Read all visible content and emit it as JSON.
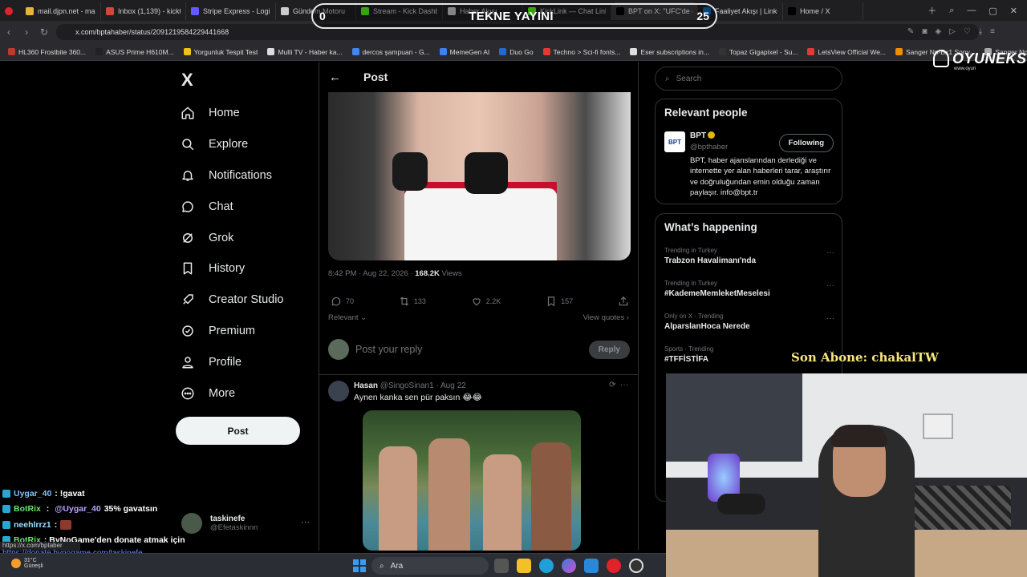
{
  "browser": {
    "tabs": [
      {
        "label": "mail.djpn.net - mail UI",
        "color": "#e7b43a"
      },
      {
        "label": "Inbox (1,139) - kicktaskin",
        "color": "#d44638"
      },
      {
        "label": "Stripe Express - Login",
        "color": "#635bff"
      },
      {
        "label": "Gündem Motoru",
        "color": "#cccccc"
      },
      {
        "label": "Stream - Kick Dashboard",
        "color": "#53fc18"
      },
      {
        "label": "Haber Akışı",
        "color": "#cccccc"
      },
      {
        "label": "KickLink — Chat Link To",
        "color": "#53fc18"
      },
      {
        "label": "BPT on X: \"UFC'de dövüşçü",
        "color": "#000000",
        "active": true
      },
      {
        "label": "Faaliyet Akışı | LinkedIn",
        "color": "#0a66c2"
      },
      {
        "label": "Home / X",
        "color": "#000000"
      }
    ],
    "url": "x.com/bptahaber/status/2091219584229441668",
    "bookmarks": [
      {
        "label": "HL360 Frostbite 360...",
        "color": "#c0392b"
      },
      {
        "label": "ASUS Prime H610M...",
        "color": "#222222"
      },
      {
        "label": "Yorgunluk Tespit Test",
        "color": "#f1c40f"
      },
      {
        "label": "Multi TV - Haber ka...",
        "color": "#dddddd"
      },
      {
        "label": "dercos şampuan - G...",
        "color": "#4285f4"
      },
      {
        "label": "MemeGen AI",
        "color": "#3b82f6"
      },
      {
        "label": "Duo Go",
        "color": "#1e6bd6"
      },
      {
        "label": "Techno > Sci-fi fonts...",
        "color": "#e53935"
      },
      {
        "label": "Eser subscriptions in...",
        "color": "#dddddd"
      },
      {
        "label": "Topaz Gigapixel - Su...",
        "color": "#333333"
      },
      {
        "label": "LetsView Official We...",
        "color": "#e53935"
      },
      {
        "label": "Sanger Np-Bx1 Sony...",
        "color": "#f08c00"
      },
      {
        "label": "Sanger Np-Bx1 Son...",
        "color": "#aaaaaa"
      }
    ]
  },
  "sidebar": {
    "logo": "X",
    "items": [
      {
        "label": "Home",
        "icon": "home-icon"
      },
      {
        "label": "Explore",
        "icon": "search-icon"
      },
      {
        "label": "Notifications",
        "icon": "bell-icon"
      },
      {
        "label": "Chat",
        "icon": "chat-icon"
      },
      {
        "label": "Grok",
        "icon": "grok-icon"
      },
      {
        "label": "History",
        "icon": "bookmark-icon"
      },
      {
        "label": "Creator Studio",
        "icon": "rocket-icon"
      },
      {
        "label": "Premium",
        "icon": "verified-icon"
      },
      {
        "label": "Profile",
        "icon": "person-icon"
      },
      {
        "label": "More",
        "icon": "more-circle-icon"
      }
    ],
    "post_button": "Post",
    "account": {
      "name": "taskinefe",
      "handle": "@Efetaskinnn"
    }
  },
  "post": {
    "header": "Post",
    "timestamp": "8:42 PM · Aug 22, 2026 · ",
    "views_count": "168.2K",
    "views_label": " Views",
    "replies": "70",
    "reposts": "133",
    "likes": "2.2K",
    "bookmarks": "157",
    "sort": "Relevant ⌄",
    "view_quotes": "View quotes ›",
    "reply_placeholder": "Post your reply",
    "reply_button": "Reply"
  },
  "reply": {
    "name": "Hasan",
    "handle": "@SingoSinan1 · Aug 22",
    "text": "Aynen kanka sen pür paksın 😂😂"
  },
  "right": {
    "search_placeholder": "Search",
    "relevant_title": "Relevant people",
    "person": {
      "avatar_text": "BPT",
      "name": "BPT",
      "handle": "@bpthaber",
      "follow": "Following",
      "bio": "BPT, haber ajanslarından derlediği ve internette yer alan haberleri tarar, araştırır ve doğruluğundan emin olduğu zaman paylaşır. info@bpt.tr"
    },
    "happening_title": "What’s happening",
    "trends": [
      {
        "context": "Trending in Turkey",
        "title": "Trabzon Havalimanı'nda"
      },
      {
        "context": "Trending in Turkey",
        "title": "#KademeMemleketMeselesi"
      },
      {
        "context": "Only on X · Trending",
        "title": "AlparslanHoca Nerede"
      },
      {
        "context": "Sports · Trending",
        "title": "#TFFİSTİFA"
      }
    ]
  },
  "overlay": {
    "score_left": "0",
    "score_title": "TEKNE YAYINI",
    "score_right": "25",
    "brand": "OYUNEKS",
    "brand_sub": "www.oyun",
    "last_sub": "Son Abone: chakalTW"
  },
  "chat": [
    {
      "user": "Uygar_40",
      "message": " : !gavat"
    },
    {
      "user": "BotRix",
      "mention": "@Uygar_40",
      "message": " 35% gavatsın"
    },
    {
      "user": "neehlrrz1",
      "message": " : "
    },
    {
      "user": "BotRix",
      "message": " : ByNoGame'den donate atmak için"
    }
  ],
  "status_url": "https://x.com/bptaber",
  "donate_link": "https://donate.bynogame.com/taskinefe",
  "taskbar": {
    "weather_temp": "31°C",
    "weather_label": "Güneşli",
    "search_label": "Ara"
  }
}
